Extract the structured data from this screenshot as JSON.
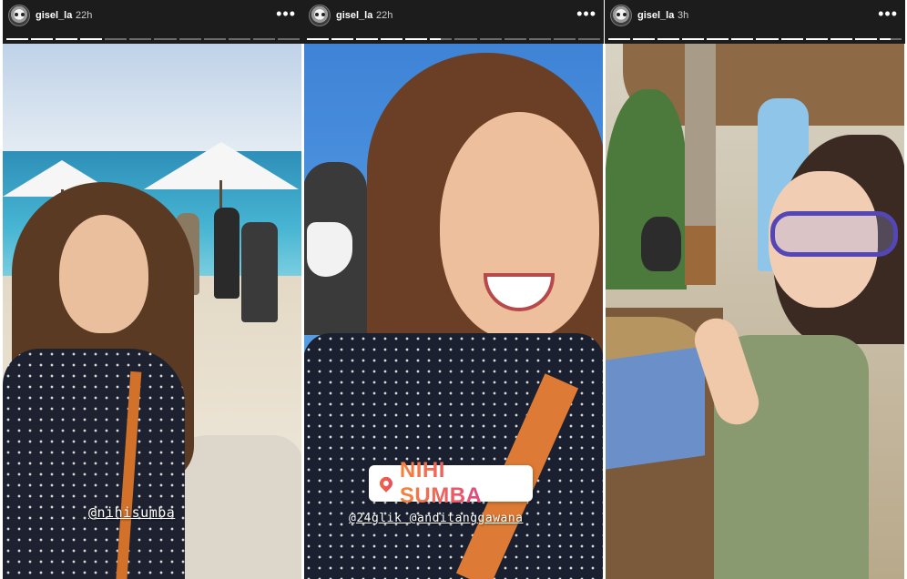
{
  "stories": [
    {
      "username": "gisel_la",
      "time": "22h",
      "more": "•••",
      "mentions": [
        "@nihisumba"
      ],
      "location": ""
    },
    {
      "username": "gisel_la",
      "time": "22h",
      "more": "•••",
      "mentions": [
        "@24glik @anditanggawana"
      ],
      "location": "NIHI SUMBA"
    },
    {
      "username": "gisel_la",
      "time": "3h",
      "more": "•••",
      "mentions": [],
      "location": ""
    }
  ],
  "colors": {
    "header_bg": "#1c1c1c",
    "location_gradient_start": "#f5843b",
    "location_gradient_end": "#b13ca6"
  },
  "icons": {
    "avatar": "profile-avatar",
    "more": "more-horizontal-icon",
    "location": "location-pin-icon"
  }
}
